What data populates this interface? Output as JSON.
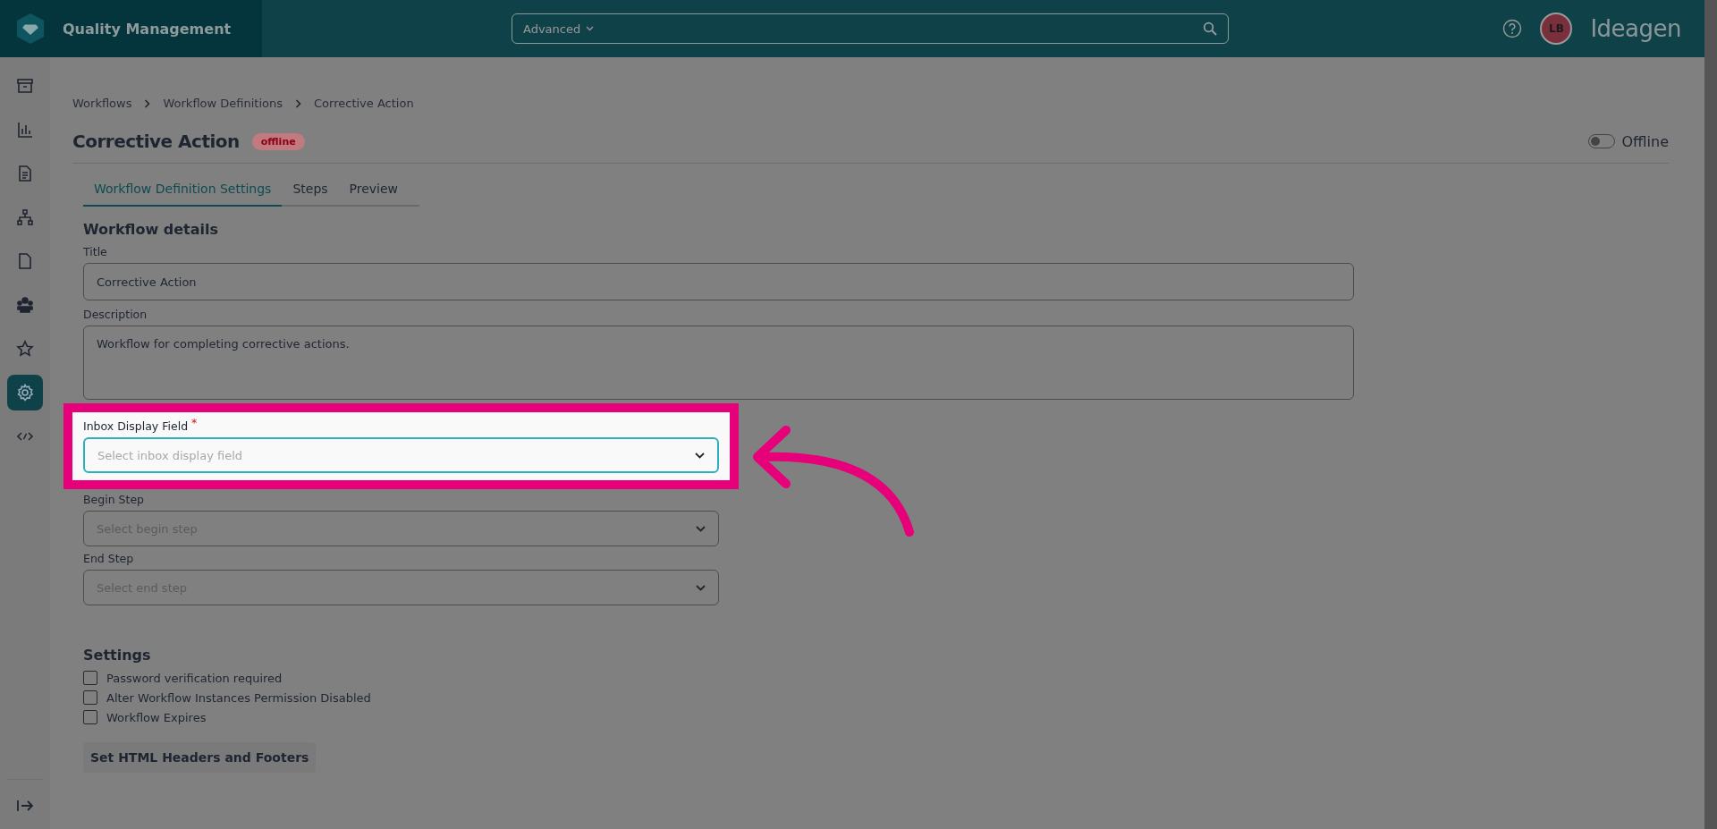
{
  "app": {
    "title": "Quality Management",
    "search": {
      "filter": "Advanced"
    },
    "avatar": "LB",
    "logo": "Ideagen"
  },
  "sidebar": {
    "items": [
      {
        "selected": false
      },
      {
        "selected": false
      },
      {
        "selected": false
      },
      {
        "selected": false
      },
      {
        "selected": false
      },
      {
        "selected": false
      },
      {
        "selected": false
      },
      {
        "selected": true
      },
      {
        "selected": false
      }
    ]
  },
  "breadcrumb": [
    "Workflows",
    "Workflow Definitions",
    "Corrective Action"
  ],
  "header": {
    "title": "Corrective Action",
    "badge": "offline",
    "toggle": {
      "label": "Offline",
      "on": false
    }
  },
  "tabs": [
    {
      "label": "Workflow Definition Settings",
      "selected": true
    },
    {
      "label": "Steps",
      "selected": false
    },
    {
      "label": "Preview",
      "selected": false
    }
  ],
  "details": {
    "heading": "Workflow details",
    "title": {
      "label": "Title",
      "value": "Corrective Action"
    },
    "description": {
      "label": "Description",
      "value": "Workflow for completing corrective actions."
    },
    "selects": [
      {
        "label": "Inbox Display Field",
        "required": "*",
        "placeholder": "Select inbox display field",
        "highlighted": true
      },
      {
        "label": "Begin Step",
        "placeholder": "Select begin step",
        "highlighted": false
      },
      {
        "label": "End Step",
        "placeholder": "Select end step",
        "highlighted": false
      }
    ]
  },
  "settings": {
    "heading": "Settings",
    "options": [
      {
        "label": "Password verification required",
        "checked": false
      },
      {
        "label": "Alter Workflow Instances Permission Disabled",
        "checked": false
      },
      {
        "label": "Workflow Expires",
        "checked": false
      }
    ],
    "button": "Set HTML Headers and Footers"
  }
}
